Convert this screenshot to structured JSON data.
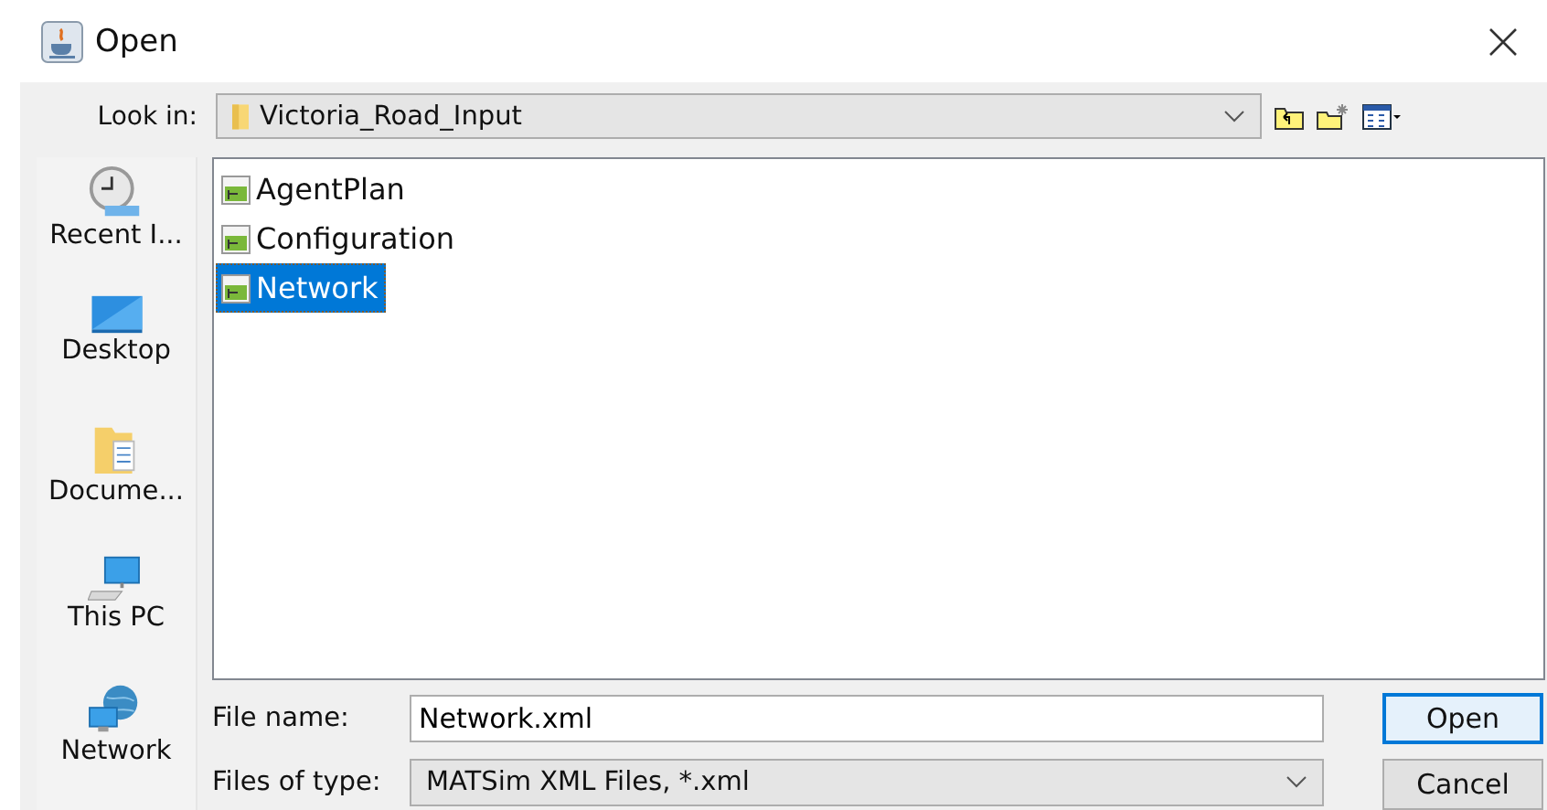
{
  "window": {
    "title": "Open"
  },
  "look_in": {
    "label": "Look in:",
    "value": "Victoria_Road_Input"
  },
  "places": [
    {
      "label": "Recent I...",
      "kind": "recent"
    },
    {
      "label": "Desktop",
      "kind": "desktop"
    },
    {
      "label": "Docume...",
      "kind": "documents"
    },
    {
      "label": "This PC",
      "kind": "pc"
    },
    {
      "label": "Network",
      "kind": "network"
    }
  ],
  "files": [
    {
      "name": "AgentPlan",
      "selected": false
    },
    {
      "name": "Configuration",
      "selected": false
    },
    {
      "name": "Network",
      "selected": true
    }
  ],
  "file_name": {
    "label": "File name:",
    "value": "Network.xml"
  },
  "file_type": {
    "label": "Files of type:",
    "value": "MATSim XML Files, *.xml"
  },
  "buttons": [
    {
      "label": "Open",
      "kind": "default"
    },
    {
      "label": "Cancel",
      "kind": "normal"
    }
  ]
}
